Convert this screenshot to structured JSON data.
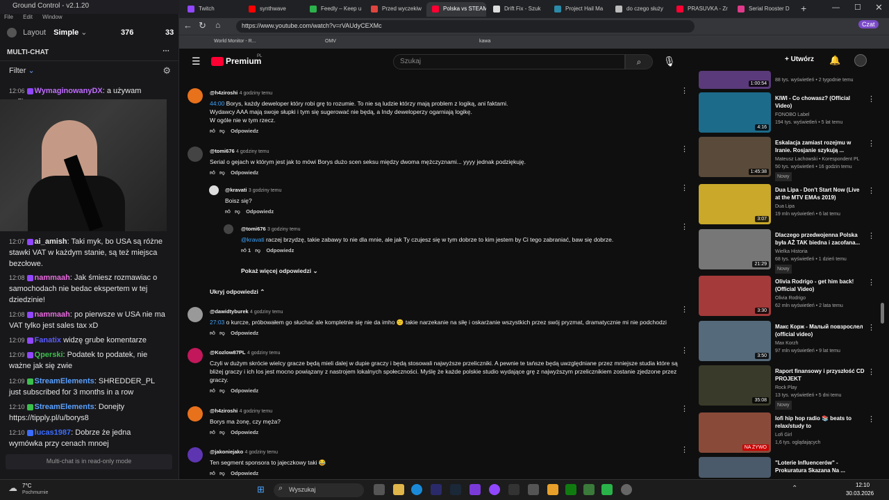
{
  "gc": {
    "title": "Ground Control - v2.1.20",
    "menu": [
      "File",
      "Edit",
      "Window"
    ],
    "layout": "Layout",
    "mode": "Simple",
    "viewers": "376",
    "viewers2": "33",
    "multichat": "MULTI-CHAT",
    "filter": "Filter",
    "readonly": "Multi-chat is in read-only mode",
    "messages": [
      {
        "t": "12:06",
        "user": "WymaginowanyDX",
        "text": "a używam upflixa",
        "color": "#c06cff"
      },
      {
        "t": "12:07",
        "user": "ai_amish",
        "text": "Taki myk, bo USA są różne stawki VAT w każdym stanie, są też miejsca bezcłowe.",
        "color": "#ffffff"
      },
      {
        "t": "12:08",
        "user": "nammaah",
        "text": "Jak śmiesz rozmawiac o samochodach nie bedac ekspertem w tej dziedzinie!",
        "color": "#e66bdc"
      },
      {
        "t": "12:08",
        "user": "nammaah",
        "text": "po pierwsze w USA nie ma VAT tylko jest sales tax xD",
        "color": "#e66bdc"
      },
      {
        "t": "12:09",
        "user": "Fanatix",
        "text": "widzę grube komentarze",
        "color": "#5b5bff"
      },
      {
        "t": "12:09",
        "user": "Qperski",
        "text": "Podatek to podatek, nie ważne jak się zwie",
        "color": "#3cbf4c"
      },
      {
        "t": "12:09",
        "user": "StreamElements",
        "text": "SHREDDER_PL just subscribed for 3 months in a row",
        "color": "#5aa0ff"
      },
      {
        "t": "12:10",
        "user": "StreamElements",
        "text": "Donejty https://tipply.pl/u/borys8",
        "color": "#5aa0ff"
      },
      {
        "t": "12:10",
        "user": "lucas1987",
        "text": "Dobrze że jedna wymówka przy cenach mnoej",
        "color": "#3b6cff"
      }
    ]
  },
  "browser": {
    "tabs": [
      "Twitch",
      "synthwave",
      "Feedly – Keep u",
      "Przed wyczekiw",
      "Polska vs STEAM",
      "Drift Fix - Szuk",
      "Project Hail Ma",
      "do czego służy",
      "PRASUVKA - Zr",
      "Serial Rooster D"
    ],
    "url": "https://www.youtube.com/watch?v=rVAUdyCEXMc",
    "bookmarks": [
      "World Monitor - R...",
      "OMV",
      "kawa"
    ],
    "profile": "Czat"
  },
  "yt": {
    "logo": "Premium",
    "logo_sup": "PL",
    "search_placeholder": "Szukaj",
    "create": "Utwórz"
  },
  "comments": [
    {
      "author": "@h4ziroshi",
      "time": "4 godziny temu",
      "ts": "44:00",
      "text": "Borys, każdy deweloper który robi grę to rozumie. To nie są ludzie którzy mają problem z logiką, ani faktami.",
      "text2": "Wydawcy AAA mają swoje słupki i tym się sugerować nie będą, a Indy deweloperzy ogarniają logikę.",
      "text3": "W ogóle nie w tym rzecz.",
      "reply": "Odpowiedz"
    },
    {
      "author": "@tomi676",
      "time": "4 godziny temu",
      "text": "Serial o gejach w którym jest jak to mówi Borys dużo scen seksu między dwoma mężczyznami... yyyy jednak podziękuję.",
      "reply": "Odpowiedz"
    },
    {
      "author": "@kravati",
      "time": "3 godziny temu",
      "text": "Boisz się?",
      "reply": "Odpowiedz"
    },
    {
      "author": "@tomi676",
      "time": "3 godziny temu",
      "mention": "@kravati",
      "text": "raczej brzydzę, takie zabawy to nie dla mnie, ale jak Ty czujesz się w tym dobrze to kim jestem by Ci tego zabraniać, baw się dobrze.",
      "likes": "1",
      "reply": "Odpowiedz"
    },
    {
      "author": "@dawidtyburek",
      "time": "4 godziny temu",
      "ts": "27:03",
      "text": "o kurcze, próbowałem go słuchać ale kompletnie się nie da imho",
      "text2": "takie narzekanie na siłę i oskarżanie wszystkich przez swój pryzmat, dramatycznie mi nie podchodzi",
      "reply": "Odpowiedz"
    },
    {
      "author": "@Kozlow87PL",
      "time": "4 godziny temu",
      "text": "Czyli w dużym skrócie wielcy gracze będą mieli dalej w dupie graczy i będą stosowali najwyższe przeliczniki. A pewnie te tańsze będą uwzględniane przez mniejsze studia które są bliżej graczy i ich los jest mocno powiązany z nastrojem lokalnych społeczności. Myślę że każde polskie studio wydające grę z najwyższym przelicznikiem zostanie zjedzone przez graczy.",
      "reply": "Odpowiedz"
    },
    {
      "author": "@h4ziroshi",
      "time": "4 godziny temu",
      "text": "Borys ma żonę, czy męża?",
      "reply": "Odpowiedz"
    },
    {
      "author": "@jakoniejako",
      "time": "4 godziny temu",
      "text": "Ten segment sponsora to jajeczkowy taki 😂",
      "reply": "Odpowiedz"
    }
  ],
  "more_replies": "Pokaż więcej odpowiedzi",
  "hide_replies": "Ukryj odpowiedzi",
  "sidebar": [
    {
      "title": "",
      "channel": "",
      "meta": "88 tys. wyświetleń • 2 tygodnie temu",
      "dur": "1:00:54",
      "color": "#5a3a7a"
    },
    {
      "title": "KIWI - Co chowasz? (Official Video)",
      "channel": "FONOBO Label",
      "meta": "194 tys. wyświetleń • 5 lat temu",
      "dur": "4:16",
      "color": "#1d6b8a"
    },
    {
      "title": "Eskalacja zamiast rozejmu w Iranie. Rosjanie szykują ...",
      "channel": "Mateusz Lachowski • Korespondent PL",
      "meta": "50 tys. wyświetleń • 16 godzin temu",
      "dur": "1:45:38",
      "color": "#5a4a3a",
      "new": "Nowy"
    },
    {
      "title": "Dua Lipa - Don't Start Now (Live at the MTV EMAs 2019)",
      "channel": "Dua Lipa",
      "meta": "19 mln wyświetleń • 6 lat temu",
      "dur": "3:07",
      "color": "#c9a82a"
    },
    {
      "title": "Dlaczego przedwojenna Polska była AŻ TAK biedna i zacofana...",
      "channel": "Wielka Historia",
      "meta": "68 tys. wyświetleń • 1 dzień temu",
      "dur": "21:29",
      "color": "#777",
      "new": "Nowy"
    },
    {
      "title": "Olivia Rodrigo - get him back! (Official Video)",
      "channel": "Olivia Rodrigo",
      "meta": "62 mln wyświetleń • 2 lata temu",
      "dur": "3:30",
      "color": "#a43a3a"
    },
    {
      "title": "Макс Корж - Малый повзрослел (official video)",
      "channel": "Max Korzh",
      "meta": "97 mln wyświetleń • 9 lat temu",
      "dur": "3:50",
      "color": "#556a7a"
    },
    {
      "title": "Raport finansowy i przyszłość CD PROJEKT",
      "channel": "Rock Play",
      "meta": "13 tys. wyświetleń • 5 dni temu",
      "dur": "35:08",
      "color": "#3a3a2a",
      "new": "Nowy"
    },
    {
      "title": "lofi hip hop radio 📚 beats to relax/study to",
      "channel": "Lofi Girl",
      "meta": "1,6 tys. oglądających",
      "dur": "NA ŻYWO",
      "color": "#8a4a3a"
    },
    {
      "title": "\"Loterie Influencerów\" - Prokuratura Skazana Na ...",
      "channel": "",
      "meta": "",
      "dur": "",
      "color": "#4a5a6a"
    }
  ],
  "taskbar": {
    "temp": "7°C",
    "weather": "Pochmurnie",
    "search": "Wyszukaj",
    "time": "12:10",
    "date": "30.03.2026"
  }
}
